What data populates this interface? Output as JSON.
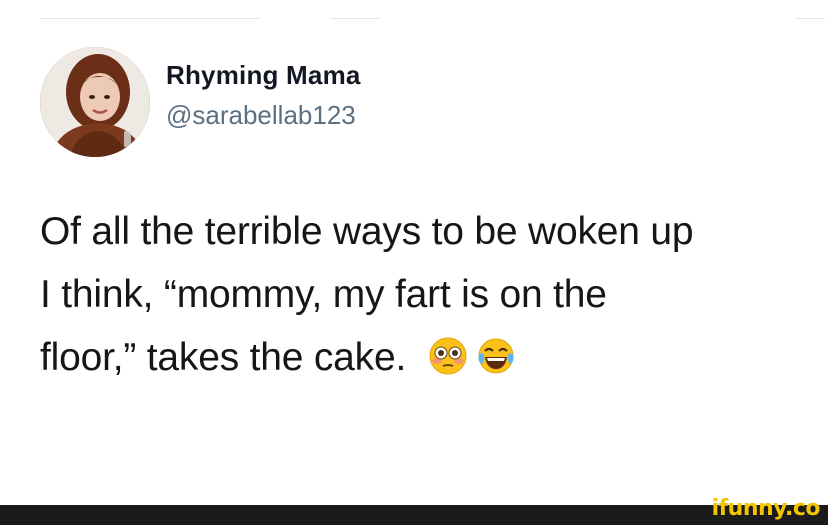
{
  "tweet": {
    "display_name": "Rhyming Mama",
    "handle": "@sarabellab123",
    "text_lines": [
      "Of all the terrible ways to be woken up",
      "I think, “mommy, my fart is on the",
      "floor,” takes the cake."
    ],
    "emojis": [
      "flushed-face-icon",
      "tears-of-joy-face-icon"
    ]
  },
  "watermark": {
    "label": "ifunny.co"
  },
  "colors": {
    "name": "#141823",
    "handle": "#5b7083",
    "text": "#14171a",
    "watermark": "#f5c400",
    "footer": "#1b1b1b"
  }
}
